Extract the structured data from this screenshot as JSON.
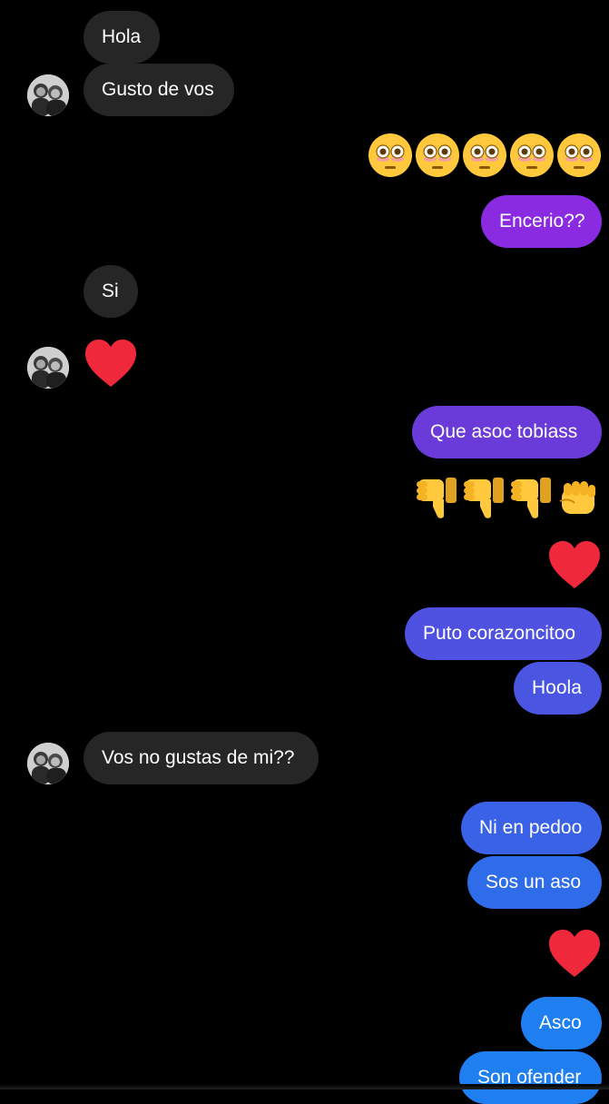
{
  "messages": {
    "m1": "Hola",
    "m2": "Gusto de vos",
    "m3": "😳😳😳😳😳",
    "m4": "Encerio??",
    "m5": "Si",
    "m6": "❤️",
    "m7": "Que asoc tobiass",
    "m8": "👎👎👎👊",
    "m9": "❤️",
    "m10": "Puto corazoncitoo",
    "m11": "Hoola",
    "m12": "Vos no gustas de mi??",
    "m13": "Ni en pedoo",
    "m14": "Sos un aso",
    "m15": "❤️",
    "m16": "Asco",
    "m17": "Son ofender"
  },
  "colors": {
    "background": "#000000",
    "incoming_bubble": "#262626",
    "heart": "#f0283c",
    "outgoing_gradient": [
      "#8a2be2",
      "#6a3bd8",
      "#4f52e0",
      "#3a62e6",
      "#1f7ef0"
    ]
  },
  "icons": {
    "avatar": "contact-avatar-icon",
    "flushed": "flushed-face-icon",
    "thumbs_down": "thumbs-down-icon",
    "fist": "oncoming-fist-icon",
    "heart": "red-heart-icon"
  }
}
